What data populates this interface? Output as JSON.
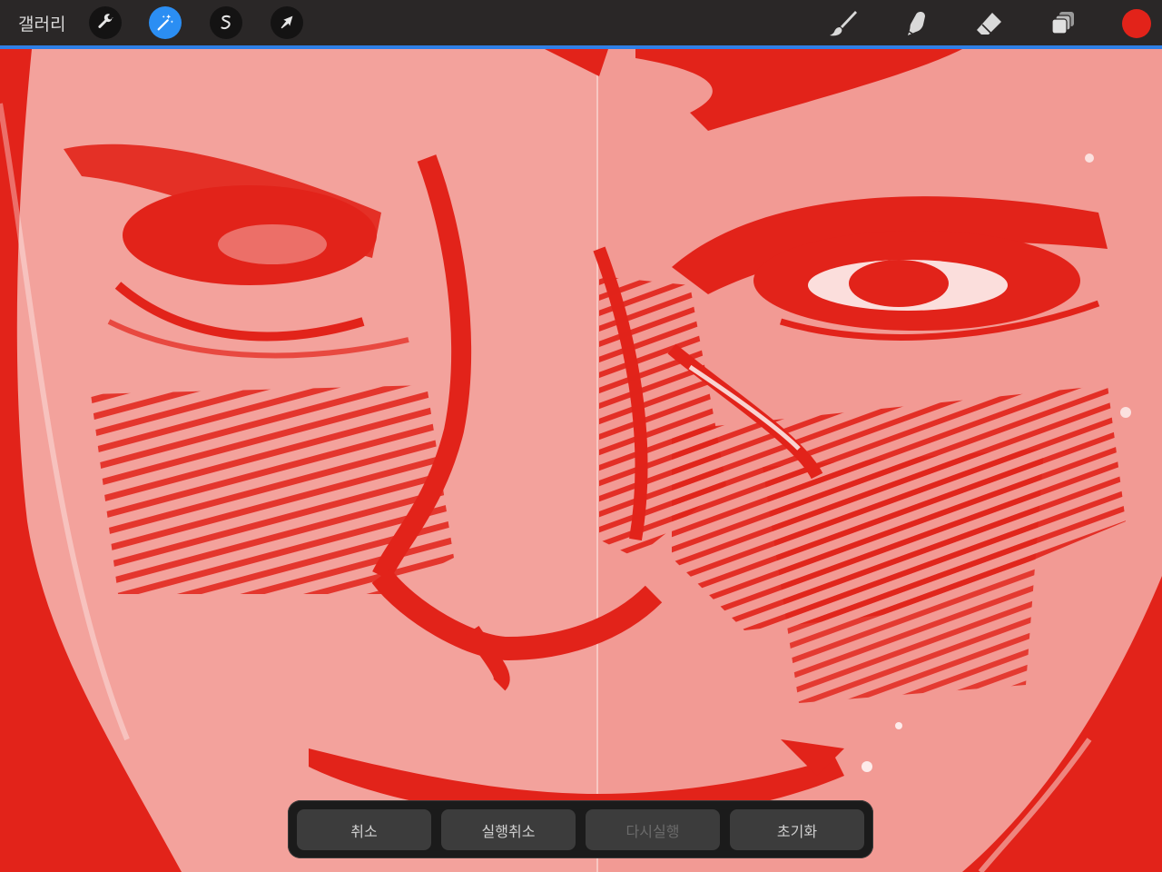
{
  "toolbar": {
    "gallery_label": "갤러리",
    "left_tools": [
      {
        "name": "actions",
        "icon": "wrench-icon",
        "active": false
      },
      {
        "name": "adjustments",
        "icon": "magic-wand-icon",
        "active": true
      },
      {
        "name": "selection",
        "icon": "selection-s-icon",
        "active": false
      },
      {
        "name": "transform",
        "icon": "arrow-cursor-icon",
        "active": false
      }
    ],
    "right_tools": [
      {
        "name": "brush",
        "icon": "brush-icon"
      },
      {
        "name": "smudge",
        "icon": "smudge-finger-icon"
      },
      {
        "name": "eraser",
        "icon": "eraser-icon"
      },
      {
        "name": "layers",
        "icon": "layers-icon"
      }
    ],
    "current_color": "#e2231a",
    "accent_color": "#2b8ef3"
  },
  "canvas": {
    "artwork": "red crayon sketch of a face, split comparison view"
  },
  "action_bar": {
    "buttons": [
      {
        "label": "취소",
        "enabled": true
      },
      {
        "label": "실행취소",
        "enabled": true
      },
      {
        "label": "다시실행",
        "enabled": false
      },
      {
        "label": "초기화",
        "enabled": true
      }
    ]
  }
}
